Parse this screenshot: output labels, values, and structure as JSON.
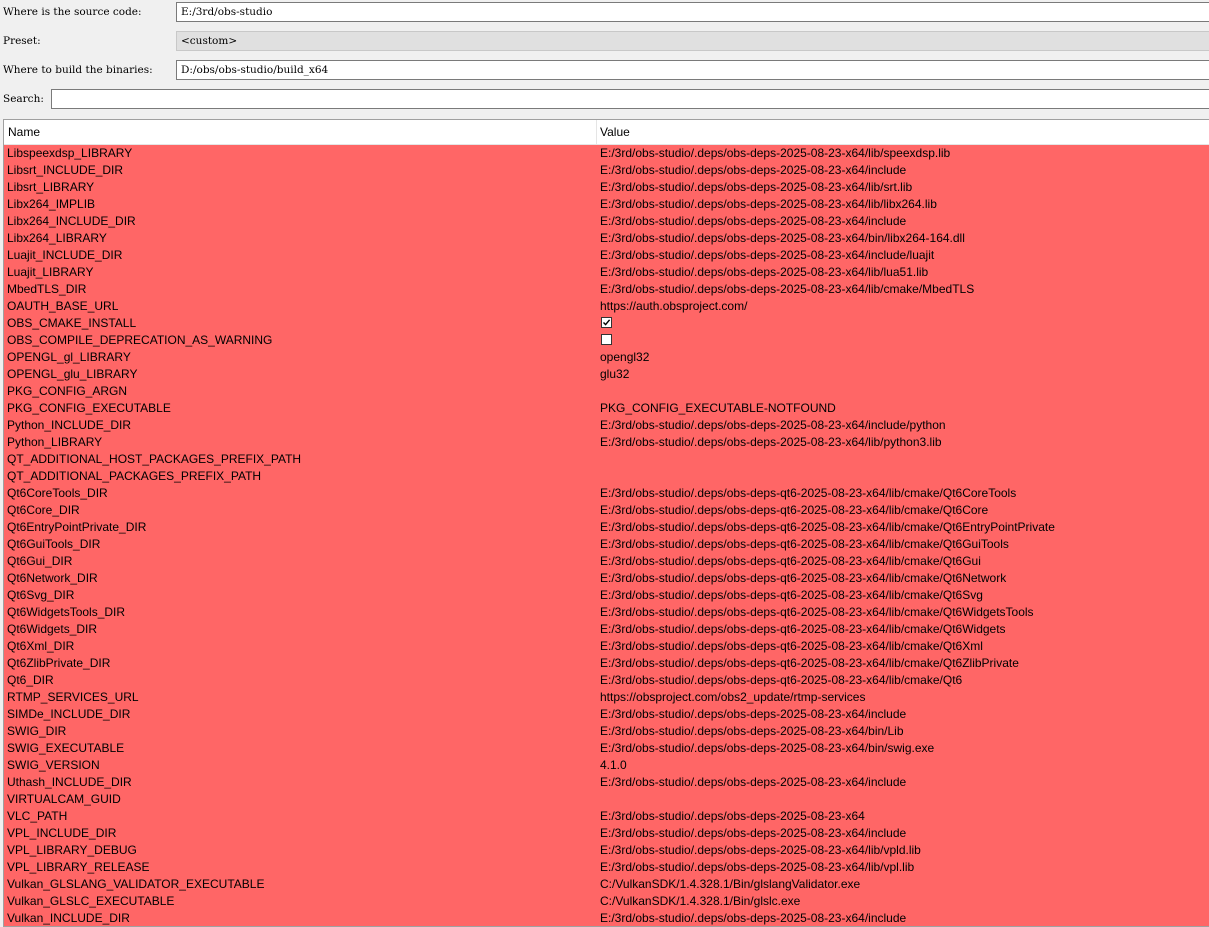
{
  "form": {
    "source_label": "Where is the source code:",
    "source_value": "E:/3rd/obs-studio",
    "preset_label": "Preset:",
    "preset_value": "<custom>",
    "build_label": "Where to build the binaries:",
    "build_value": "D:/obs/obs-studio/build_x64",
    "search_label": "Search:",
    "search_value": ""
  },
  "colors": {
    "changed_row_bg": "#ff6666"
  },
  "table": {
    "columns": [
      "Name",
      "Value"
    ],
    "rows": [
      {
        "name": "Libspeexdsp_LIBRARY",
        "value": "E:/3rd/obs-studio/.deps/obs-deps-2025-08-23-x64/lib/speexdsp.lib"
      },
      {
        "name": "Libsrt_INCLUDE_DIR",
        "value": "E:/3rd/obs-studio/.deps/obs-deps-2025-08-23-x64/include"
      },
      {
        "name": "Libsrt_LIBRARY",
        "value": "E:/3rd/obs-studio/.deps/obs-deps-2025-08-23-x64/lib/srt.lib"
      },
      {
        "name": "Libx264_IMPLIB",
        "value": "E:/3rd/obs-studio/.deps/obs-deps-2025-08-23-x64/lib/libx264.lib"
      },
      {
        "name": "Libx264_INCLUDE_DIR",
        "value": "E:/3rd/obs-studio/.deps/obs-deps-2025-08-23-x64/include"
      },
      {
        "name": "Libx264_LIBRARY",
        "value": "E:/3rd/obs-studio/.deps/obs-deps-2025-08-23-x64/bin/libx264-164.dll"
      },
      {
        "name": "Luajit_INCLUDE_DIR",
        "value": "E:/3rd/obs-studio/.deps/obs-deps-2025-08-23-x64/include/luajit"
      },
      {
        "name": "Luajit_LIBRARY",
        "value": "E:/3rd/obs-studio/.deps/obs-deps-2025-08-23-x64/lib/lua51.lib"
      },
      {
        "name": "MbedTLS_DIR",
        "value": "E:/3rd/obs-studio/.deps/obs-deps-2025-08-23-x64/lib/cmake/MbedTLS"
      },
      {
        "name": "OAUTH_BASE_URL",
        "value": "https://auth.obsproject.com/"
      },
      {
        "name": "OBS_CMAKE_INSTALL",
        "checkbox": true,
        "checked": true
      },
      {
        "name": "OBS_COMPILE_DEPRECATION_AS_WARNING",
        "checkbox": true,
        "checked": false
      },
      {
        "name": "OPENGL_gl_LIBRARY",
        "value": "opengl32"
      },
      {
        "name": "OPENGL_glu_LIBRARY",
        "value": "glu32"
      },
      {
        "name": "PKG_CONFIG_ARGN",
        "value": ""
      },
      {
        "name": "PKG_CONFIG_EXECUTABLE",
        "value": "PKG_CONFIG_EXECUTABLE-NOTFOUND"
      },
      {
        "name": "Python_INCLUDE_DIR",
        "value": "E:/3rd/obs-studio/.deps/obs-deps-2025-08-23-x64/include/python"
      },
      {
        "name": "Python_LIBRARY",
        "value": "E:/3rd/obs-studio/.deps/obs-deps-2025-08-23-x64/lib/python3.lib"
      },
      {
        "name": "QT_ADDITIONAL_HOST_PACKAGES_PREFIX_PATH",
        "value": ""
      },
      {
        "name": "QT_ADDITIONAL_PACKAGES_PREFIX_PATH",
        "value": ""
      },
      {
        "name": "Qt6CoreTools_DIR",
        "value": "E:/3rd/obs-studio/.deps/obs-deps-qt6-2025-08-23-x64/lib/cmake/Qt6CoreTools"
      },
      {
        "name": "Qt6Core_DIR",
        "value": "E:/3rd/obs-studio/.deps/obs-deps-qt6-2025-08-23-x64/lib/cmake/Qt6Core"
      },
      {
        "name": "Qt6EntryPointPrivate_DIR",
        "value": "E:/3rd/obs-studio/.deps/obs-deps-qt6-2025-08-23-x64/lib/cmake/Qt6EntryPointPrivate"
      },
      {
        "name": "Qt6GuiTools_DIR",
        "value": "E:/3rd/obs-studio/.deps/obs-deps-qt6-2025-08-23-x64/lib/cmake/Qt6GuiTools"
      },
      {
        "name": "Qt6Gui_DIR",
        "value": "E:/3rd/obs-studio/.deps/obs-deps-qt6-2025-08-23-x64/lib/cmake/Qt6Gui"
      },
      {
        "name": "Qt6Network_DIR",
        "value": "E:/3rd/obs-studio/.deps/obs-deps-qt6-2025-08-23-x64/lib/cmake/Qt6Network"
      },
      {
        "name": "Qt6Svg_DIR",
        "value": "E:/3rd/obs-studio/.deps/obs-deps-qt6-2025-08-23-x64/lib/cmake/Qt6Svg"
      },
      {
        "name": "Qt6WidgetsTools_DIR",
        "value": "E:/3rd/obs-studio/.deps/obs-deps-qt6-2025-08-23-x64/lib/cmake/Qt6WidgetsTools"
      },
      {
        "name": "Qt6Widgets_DIR",
        "value": "E:/3rd/obs-studio/.deps/obs-deps-qt6-2025-08-23-x64/lib/cmake/Qt6Widgets"
      },
      {
        "name": "Qt6Xml_DIR",
        "value": "E:/3rd/obs-studio/.deps/obs-deps-qt6-2025-08-23-x64/lib/cmake/Qt6Xml"
      },
      {
        "name": "Qt6ZlibPrivate_DIR",
        "value": "E:/3rd/obs-studio/.deps/obs-deps-qt6-2025-08-23-x64/lib/cmake/Qt6ZlibPrivate"
      },
      {
        "name": "Qt6_DIR",
        "value": "E:/3rd/obs-studio/.deps/obs-deps-qt6-2025-08-23-x64/lib/cmake/Qt6"
      },
      {
        "name": "RTMP_SERVICES_URL",
        "value": "https://obsproject.com/obs2_update/rtmp-services"
      },
      {
        "name": "SIMDe_INCLUDE_DIR",
        "value": "E:/3rd/obs-studio/.deps/obs-deps-2025-08-23-x64/include"
      },
      {
        "name": "SWIG_DIR",
        "value": "E:/3rd/obs-studio/.deps/obs-deps-2025-08-23-x64/bin/Lib"
      },
      {
        "name": "SWIG_EXECUTABLE",
        "value": "E:/3rd/obs-studio/.deps/obs-deps-2025-08-23-x64/bin/swig.exe"
      },
      {
        "name": "SWIG_VERSION",
        "value": "4.1.0"
      },
      {
        "name": "Uthash_INCLUDE_DIR",
        "value": "E:/3rd/obs-studio/.deps/obs-deps-2025-08-23-x64/include"
      },
      {
        "name": "VIRTUALCAM_GUID",
        "value": ""
      },
      {
        "name": "VLC_PATH",
        "value": "E:/3rd/obs-studio/.deps/obs-deps-2025-08-23-x64"
      },
      {
        "name": "VPL_INCLUDE_DIR",
        "value": "E:/3rd/obs-studio/.deps/obs-deps-2025-08-23-x64/include"
      },
      {
        "name": "VPL_LIBRARY_DEBUG",
        "value": "E:/3rd/obs-studio/.deps/obs-deps-2025-08-23-x64/lib/vpld.lib"
      },
      {
        "name": "VPL_LIBRARY_RELEASE",
        "value": "E:/3rd/obs-studio/.deps/obs-deps-2025-08-23-x64/lib/vpl.lib"
      },
      {
        "name": "Vulkan_GLSLANG_VALIDATOR_EXECUTABLE",
        "value": "C:/VulkanSDK/1.4.328.1/Bin/glslangValidator.exe"
      },
      {
        "name": "Vulkan_GLSLC_EXECUTABLE",
        "value": "C:/VulkanSDK/1.4.328.1/Bin/glslc.exe"
      },
      {
        "name": "Vulkan_INCLUDE_DIR",
        "value": "E:/3rd/obs-studio/.deps/obs-deps-2025-08-23-x64/include"
      }
    ]
  }
}
